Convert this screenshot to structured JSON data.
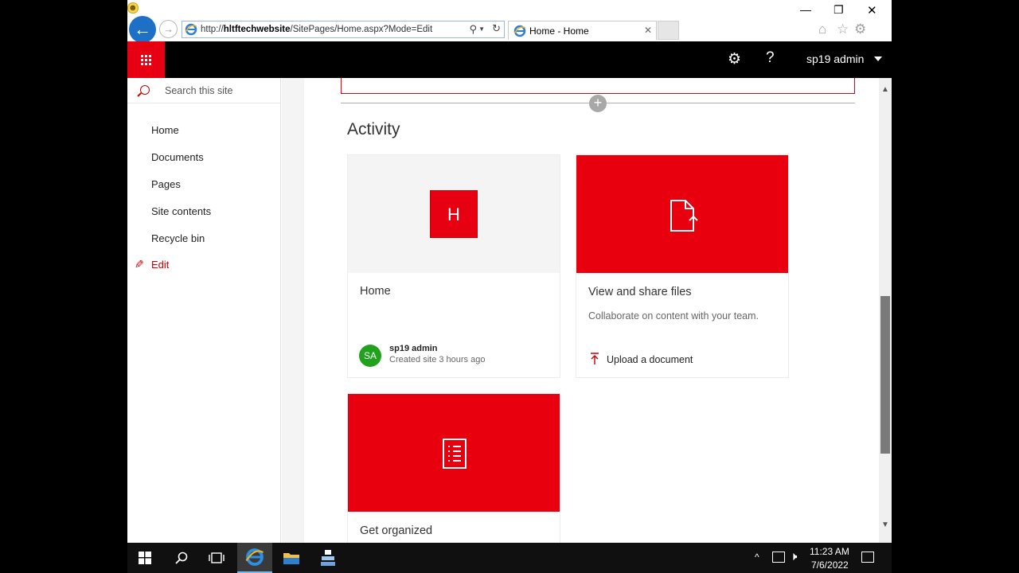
{
  "browser": {
    "url_prefix": "http://",
    "url_host": "hltftechwebsite",
    "url_path": "/SitePages/Home.aspx?Mode=Edit",
    "tab_title": "Home - Home"
  },
  "suite": {
    "user_name": "sp19 admin"
  },
  "leftnav": {
    "search_placeholder": "Search this site",
    "items": [
      {
        "label": "Home"
      },
      {
        "label": "Documents"
      },
      {
        "label": "Pages"
      },
      {
        "label": "Site contents"
      },
      {
        "label": "Recycle bin"
      }
    ],
    "edit_label": "Edit"
  },
  "activity": {
    "title": "Activity",
    "home_card": {
      "tile_letter": "H",
      "title": "Home",
      "avatar_initials": "SA",
      "author": "sp19 admin",
      "meta": "Created site 3 hours ago"
    },
    "files_card": {
      "title": "View and share files",
      "description": "Collaborate on content with your team.",
      "action_label": "Upload a document"
    },
    "organize_card": {
      "title": "Get organized"
    }
  },
  "taskbar": {
    "time": "11:23 AM",
    "date": "7/6/2022"
  },
  "colors": {
    "brand_red": "#e60012",
    "ie_blue": "#1e6fc6",
    "avatar_green": "#21a21c"
  }
}
